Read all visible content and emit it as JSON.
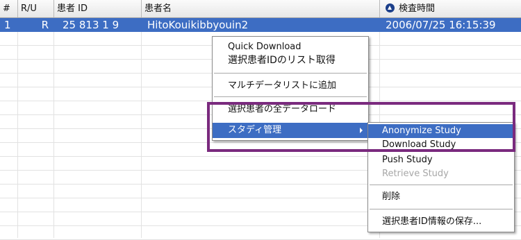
{
  "columns": {
    "index": "#",
    "ru": "R/U",
    "patient_id": "患者 ID",
    "patient_name": "患者名",
    "exam_time": "検査時間"
  },
  "selected_row": {
    "index": "1",
    "ru": "R",
    "patient_id": "25 813 1 9",
    "patient_name": "HitoKouikibbyouin2",
    "exam_time": "2006/07/25 16:15:39"
  },
  "context_menu": {
    "items": [
      "Quick Download",
      "選択患者IDのリスト取得",
      "マルチデータリストに追加",
      "選択患者の全データロード",
      "スタディ管理"
    ]
  },
  "submenu": {
    "items": [
      "Anonymize Study",
      "Download Study",
      "Push Study",
      "Retrieve Study",
      "削除",
      "選択患者ID情報の保存..."
    ]
  },
  "colors": {
    "selection": "#3d6dc3",
    "annotation_box": "#7a2a7e"
  }
}
